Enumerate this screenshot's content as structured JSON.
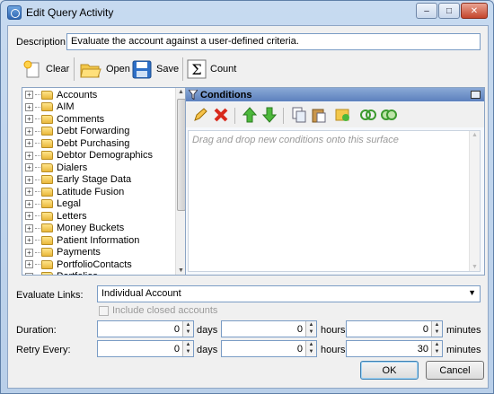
{
  "window": {
    "title": "Edit Query Activity",
    "minimize": "–",
    "maximize": "□",
    "close": "✕"
  },
  "description": {
    "label": "Description:",
    "value": "Evaluate the account against a user-defined criteria."
  },
  "toolbar": {
    "clear_label": "Clear",
    "open_label": "Open",
    "save_label": "Save",
    "count_label": "Count"
  },
  "tree": {
    "items": [
      "Accounts",
      "AIM",
      "Comments",
      "Debt Forwarding",
      "Debt Purchasing",
      "Debtor Demographics",
      "Dialers",
      "Early Stage Data",
      "Latitude Fusion",
      "Legal",
      "Letters",
      "Money Buckets",
      "Patient Information",
      "Payments",
      "PortfolioContacts",
      "Portfolios"
    ]
  },
  "conditions": {
    "title": "Conditions",
    "hint": "Drag and drop new conditions onto this surface",
    "icons": [
      "edit-icon",
      "delete-icon",
      "move-up-icon",
      "move-down-icon",
      "copy-icon",
      "paste-icon",
      "group-icon",
      "and-icon",
      "or-icon"
    ]
  },
  "evaluate_links": {
    "label": "Evaluate Links:",
    "value": "Individual Account",
    "include_closed_label": "Include closed accounts"
  },
  "duration": {
    "label": "Duration:",
    "days": "0",
    "days_unit": "days",
    "hours": "0",
    "hours_unit": "hours",
    "minutes": "0",
    "minutes_unit": "minutes"
  },
  "retry": {
    "label": "Retry Every:",
    "days": "0",
    "days_unit": "days",
    "hours": "0",
    "hours_unit": "hours",
    "minutes": "30",
    "minutes_unit": "minutes"
  },
  "buttons": {
    "ok": "OK",
    "cancel": "Cancel"
  }
}
